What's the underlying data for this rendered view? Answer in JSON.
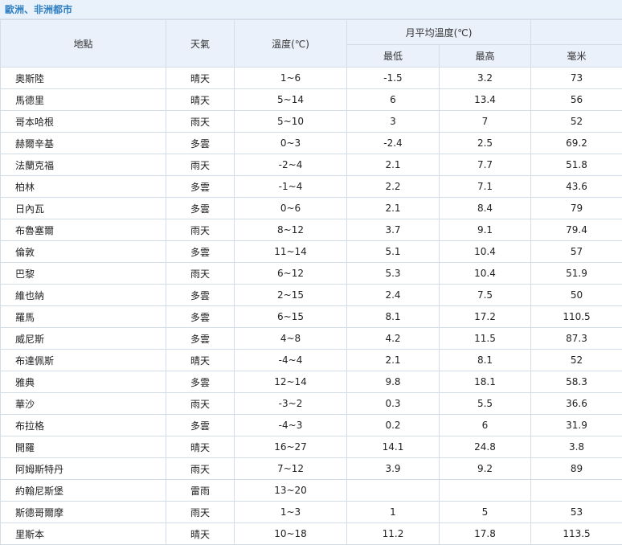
{
  "title": "歐洲、非洲都市",
  "headers": {
    "place": "地點",
    "weather": "天氣",
    "temp": "溫度(℃)",
    "monthly_avg": "月平均溫度(℃)",
    "min": "最低",
    "max": "最高",
    "mm": "毫米"
  },
  "rows": [
    {
      "city": "奧斯陸",
      "weather": "晴天",
      "temp": "1~6",
      "min": "-1.5",
      "max": "3.2",
      "mm": "73"
    },
    {
      "city": "馬德里",
      "weather": "晴天",
      "temp": "5~14",
      "min": "6",
      "max": "13.4",
      "mm": "56"
    },
    {
      "city": "哥本哈根",
      "weather": "雨天",
      "temp": "5~10",
      "min": "3",
      "max": "7",
      "mm": "52"
    },
    {
      "city": "赫爾辛基",
      "weather": "多雲",
      "temp": "0~3",
      "min": "-2.4",
      "max": "2.5",
      "mm": "69.2"
    },
    {
      "city": "法蘭克福",
      "weather": "雨天",
      "temp": "-2~4",
      "min": "2.1",
      "max": "7.7",
      "mm": "51.8"
    },
    {
      "city": "柏林",
      "weather": "多雲",
      "temp": "-1~4",
      "min": "2.2",
      "max": "7.1",
      "mm": "43.6"
    },
    {
      "city": "日內瓦",
      "weather": "多雲",
      "temp": "0~6",
      "min": "2.1",
      "max": "8.4",
      "mm": "79"
    },
    {
      "city": "布魯塞爾",
      "weather": "雨天",
      "temp": "8~12",
      "min": "3.7",
      "max": "9.1",
      "mm": "79.4"
    },
    {
      "city": "倫敦",
      "weather": "多雲",
      "temp": "11~14",
      "min": "5.1",
      "max": "10.4",
      "mm": "57"
    },
    {
      "city": "巴黎",
      "weather": "雨天",
      "temp": "6~12",
      "min": "5.3",
      "max": "10.4",
      "mm": "51.9"
    },
    {
      "city": "維也納",
      "weather": "多雲",
      "temp": "2~15",
      "min": "2.4",
      "max": "7.5",
      "mm": "50"
    },
    {
      "city": "羅馬",
      "weather": "多雲",
      "temp": "6~15",
      "min": "8.1",
      "max": "17.2",
      "mm": "110.5"
    },
    {
      "city": "威尼斯",
      "weather": "多雲",
      "temp": "4~8",
      "min": "4.2",
      "max": "11.5",
      "mm": "87.3"
    },
    {
      "city": "布達佩斯",
      "weather": "晴天",
      "temp": "-4~4",
      "min": "2.1",
      "max": "8.1",
      "mm": "52"
    },
    {
      "city": "雅典",
      "weather": "多雲",
      "temp": "12~14",
      "min": "9.8",
      "max": "18.1",
      "mm": "58.3"
    },
    {
      "city": "華沙",
      "weather": "雨天",
      "temp": "-3~2",
      "min": "0.3",
      "max": "5.5",
      "mm": "36.6"
    },
    {
      "city": "布拉格",
      "weather": "多雲",
      "temp": "-4~3",
      "min": "0.2",
      "max": "6",
      "mm": "31.9"
    },
    {
      "city": "開羅",
      "weather": "晴天",
      "temp": "16~27",
      "min": "14.1",
      "max": "24.8",
      "mm": "3.8"
    },
    {
      "city": "阿姆斯特丹",
      "weather": "雨天",
      "temp": "7~12",
      "min": "3.9",
      "max": "9.2",
      "mm": "89"
    },
    {
      "city": "約翰尼斯堡",
      "weather": "雷雨",
      "temp": "13~20",
      "min": "",
      "max": "",
      "mm": ""
    },
    {
      "city": "斯德哥爾摩",
      "weather": "雨天",
      "temp": "1~3",
      "min": "1",
      "max": "5",
      "mm": "53"
    },
    {
      "city": "里斯本",
      "weather": "晴天",
      "temp": "10~18",
      "min": "11.2",
      "max": "17.8",
      "mm": "113.5"
    }
  ]
}
